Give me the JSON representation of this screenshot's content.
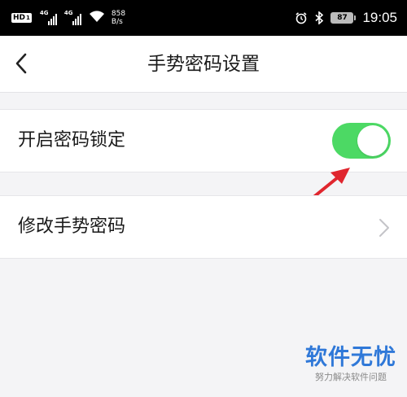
{
  "status_bar": {
    "hd": "HD",
    "hd_sub": "1",
    "signal1_tag": "4G",
    "signal2_tag": "4G",
    "net_speed": "858",
    "net_unit": "B/s",
    "battery": "87",
    "time": "19:05"
  },
  "nav": {
    "title": "手势密码设置"
  },
  "settings": {
    "lock_label": "开启密码锁定",
    "lock_enabled": true,
    "change_label": "修改手势密码"
  },
  "colors": {
    "toggle_on": "#4cd964",
    "annotation_arrow": "#e0262e",
    "watermark": "#2f78d8"
  },
  "watermark": {
    "title": "软件无忧",
    "subtitle": "努力解决软件问题"
  }
}
